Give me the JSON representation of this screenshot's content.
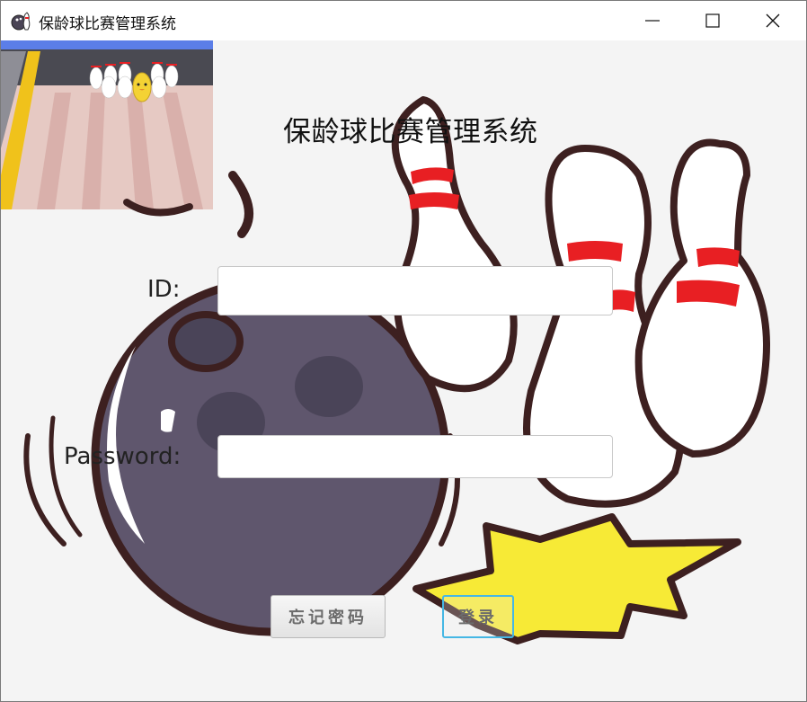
{
  "window": {
    "title": "保龄球比赛管理系统"
  },
  "header": {
    "title": "保龄球比赛管理系统"
  },
  "login_form": {
    "id_label": "ID:",
    "id_value": "",
    "password_label": "Password:",
    "password_value": ""
  },
  "buttons": {
    "forgot_password": "忘记密码",
    "login": "登录"
  },
  "colors": {
    "ball": "#5c536b",
    "pin_stripe": "#e81f23",
    "outline": "#3d2020",
    "burst": "#f7ea36",
    "accent_border": "#45b7e4"
  }
}
